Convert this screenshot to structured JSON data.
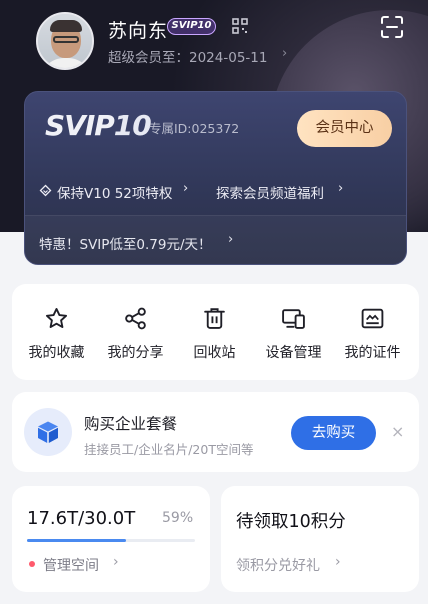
{
  "profile": {
    "username": "苏向东",
    "badge": "SVIP10",
    "expire_label": "超级会员至：2024-05-11",
    "chevron": "›"
  },
  "card": {
    "logo_svip": "SVIP",
    "logo_level": "10",
    "member_id": "专属ID:025372",
    "member_center_label": "会员中心",
    "privilege_text": "保持V10 52项特权",
    "explore_text": "探索会员频道福利",
    "promo_text": "特惠！SVIP低至0.79元/天！",
    "chevron": "›"
  },
  "menu": {
    "items": [
      {
        "label": "我的收藏",
        "icon": "star-icon"
      },
      {
        "label": "我的分享",
        "icon": "share-icon"
      },
      {
        "label": "回收站",
        "icon": "trash-icon"
      },
      {
        "label": "设备管理",
        "icon": "devices-icon"
      },
      {
        "label": "我的证件",
        "icon": "id-card-icon"
      }
    ]
  },
  "business": {
    "title": "购买企业套餐",
    "subtitle": "挂接员工/企业名片/20T空间等",
    "buy_label": "去购买",
    "close_glyph": "×",
    "icon": "cube-icon"
  },
  "storage": {
    "value": "17.6T/30.0T",
    "percent": "59%",
    "fill": 0.59,
    "manage_label": "管理空间",
    "chevron": "›"
  },
  "points": {
    "title": "待领取10积分",
    "subtitle": "领积分兑好礼",
    "chevron": "›"
  },
  "colors": {
    "accent_blue": "#2f6fe6",
    "gold_button": "#f8cfa4",
    "hero_dark": "#191926",
    "card_navy": "#313859",
    "dot_red": "#ff5a6c"
  }
}
